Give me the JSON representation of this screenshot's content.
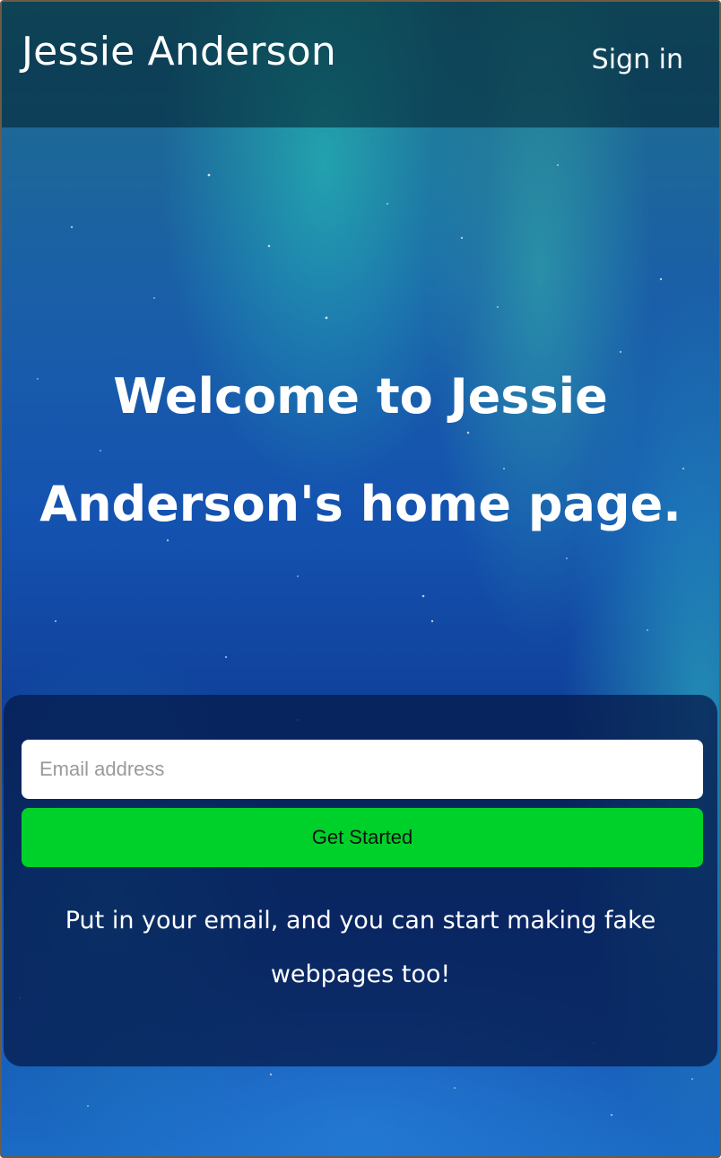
{
  "header": {
    "brand": "Jessie Anderson",
    "sign_in": "Sign in"
  },
  "hero": {
    "headline": "Welcome to Jessie Anderson's home page."
  },
  "signup": {
    "email_placeholder": "Email address",
    "email_value": "",
    "button_label": "Get Started",
    "note": "Put in your email, and you can start making fake webpages too!"
  },
  "colors": {
    "cta_green": "#00d12a",
    "panel_navy": "#061c4e",
    "sky_blue": "#1452b0",
    "aurora_teal": "#28d2be"
  }
}
